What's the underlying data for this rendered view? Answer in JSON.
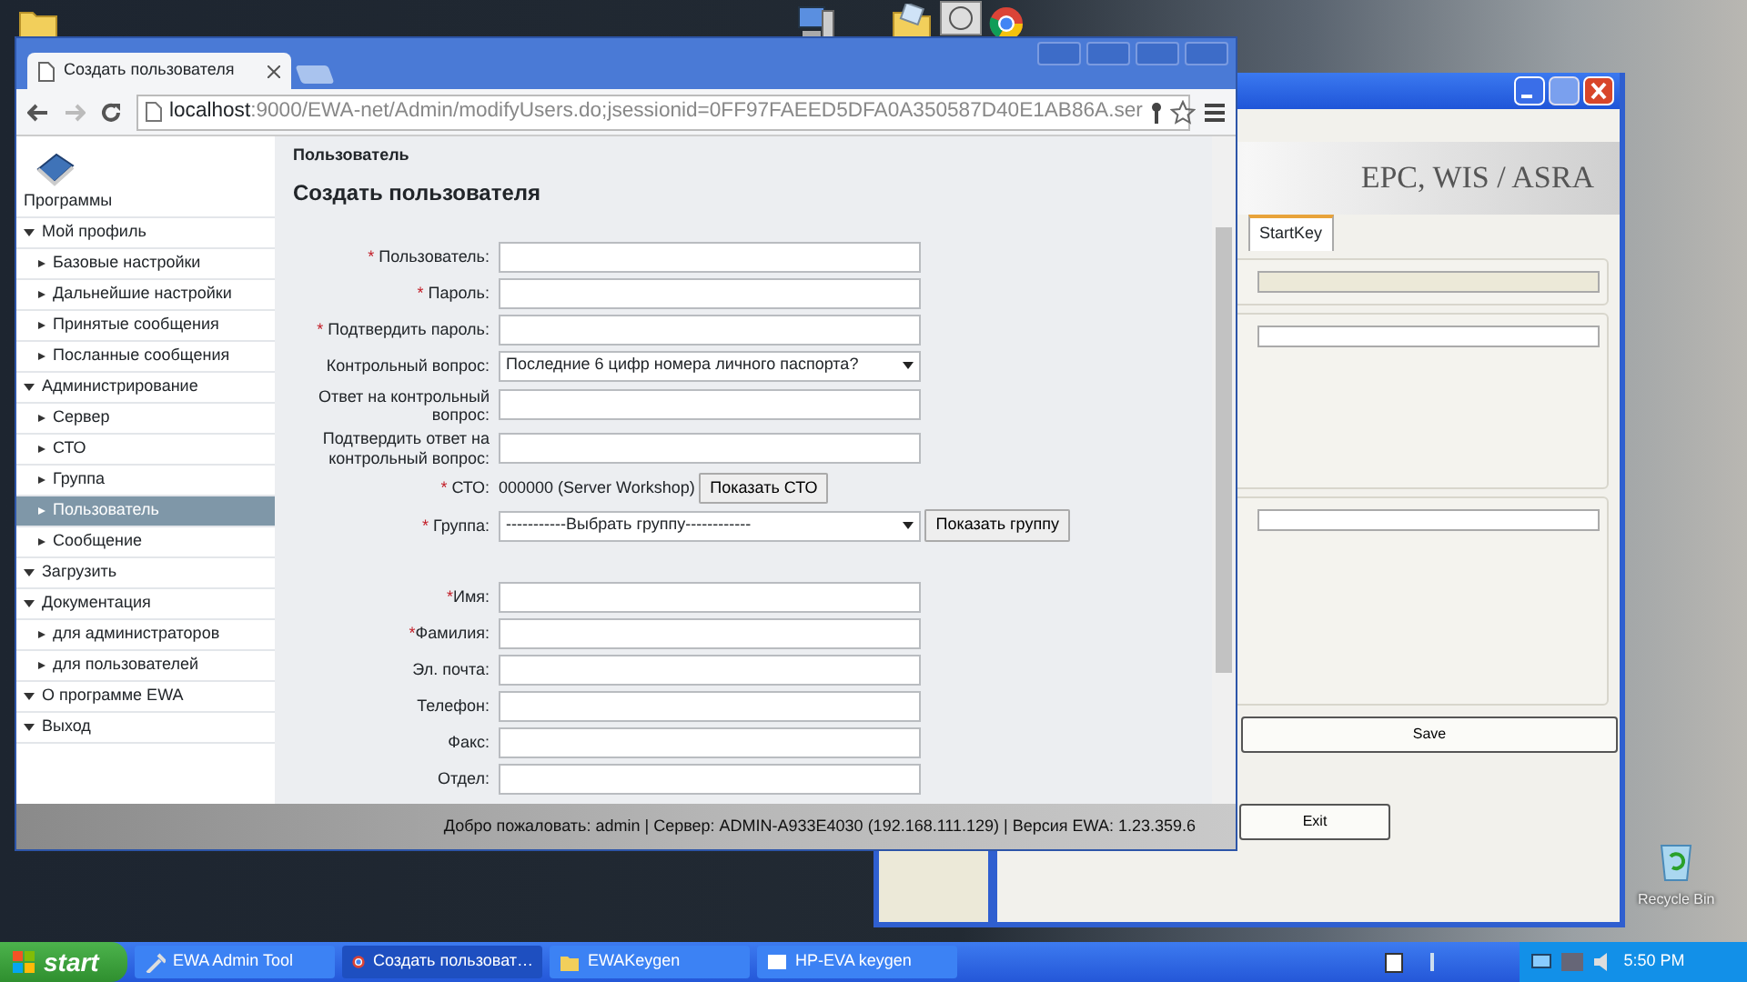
{
  "desktop": {
    "recycle_bin_label": "Recycle Bin"
  },
  "keygen_window": {
    "banner": "EPC, WIS / ASRA",
    "tabs": [
      {
        "label": "StartKey",
        "selected": true
      }
    ],
    "buttons": [
      "Save",
      "Exit"
    ]
  },
  "browser": {
    "tab_title": "Создать пользователя",
    "url_host": "localhost",
    "url_path": ":9000/EWA-net/Admin/modifyUsers.do;jsessionid=0FF97FAEED5DFA0A350587D40E1AB86A.ser",
    "sidebar": {
      "title": "Программы",
      "items": [
        {
          "label": "Мой профиль",
          "children": [
            {
              "label": "Базовые настройки",
              "selected": false
            },
            {
              "label": "Дальнейшие настройки",
              "selected": false
            },
            {
              "label": "Принятые сообщения",
              "selected": false
            },
            {
              "label": "Посланные сообщения",
              "selected": false
            }
          ]
        },
        {
          "label": "Администрирование",
          "children": [
            {
              "label": "Сервер",
              "selected": false
            },
            {
              "label": "СТО",
              "selected": false
            },
            {
              "label": "Группа",
              "selected": false
            },
            {
              "label": "Пользователь",
              "selected": true
            },
            {
              "label": "Сообщение",
              "selected": false
            }
          ]
        },
        {
          "label": "Загрузить"
        },
        {
          "label": "Документация",
          "children": [
            {
              "label": "для администраторов",
              "selected": false
            },
            {
              "label": "для пользователей",
              "selected": false
            }
          ]
        },
        {
          "label": "О программе EWA"
        },
        {
          "label": "Выход"
        }
      ]
    },
    "breadcrumb": "Пользователь",
    "title": "Создать пользователя",
    "field_groups": [
      [
        {
          "kind": "input",
          "mark": "* ",
          "label": "Пользователь:"
        },
        {
          "kind": "input",
          "mark": "* ",
          "label": "Пароль:"
        },
        {
          "kind": "input",
          "mark": "* ",
          "label": "Подтвердить пароль:"
        },
        {
          "kind": "select",
          "label": "Контрольный вопрос:",
          "value": "Последние 6 цифр номера личного паспорта?"
        },
        {
          "kind": "input",
          "label": "Ответ на контрольный вопрос:"
        },
        {
          "kind": "input",
          "label": "Подтвердить ответ на контрольный вопрос:"
        },
        {
          "kind": "text",
          "mark": "* ",
          "label": "СТО:",
          "value": "000000 (Server Workshop)",
          "button": "Показать СТО"
        },
        {
          "kind": "select",
          "mark": "* ",
          "label": "Группа:",
          "value": "-----------Выбрать группу------------",
          "button": "Показать группу"
        }
      ],
      [
        {
          "kind": "input",
          "mark": "*",
          "label": "Имя:"
        },
        {
          "kind": "input",
          "mark": "*",
          "label": "Фамилия:"
        },
        {
          "kind": "input",
          "label": "Эл. почта:"
        },
        {
          "kind": "input",
          "label": "Телефон:"
        },
        {
          "kind": "input",
          "label": "Факс:"
        },
        {
          "kind": "input",
          "label": "Отдел:"
        }
      ]
    ],
    "status_bar": "Добро пожаловать: admin | Сервер: ADMIN-A933E4030 (192.168.111.129) | Версия EWA: 1.23.359.6"
  },
  "taskbar": {
    "start": "start",
    "tasks": [
      {
        "label": "EWA Admin Tool",
        "selected": false
      },
      {
        "label": "Создать пользоват…",
        "selected": true
      },
      {
        "label": "EWAKeygen",
        "selected": false
      },
      {
        "label": "HP-EVA keygen",
        "selected": false
      }
    ],
    "clock": "5:50 PM"
  }
}
